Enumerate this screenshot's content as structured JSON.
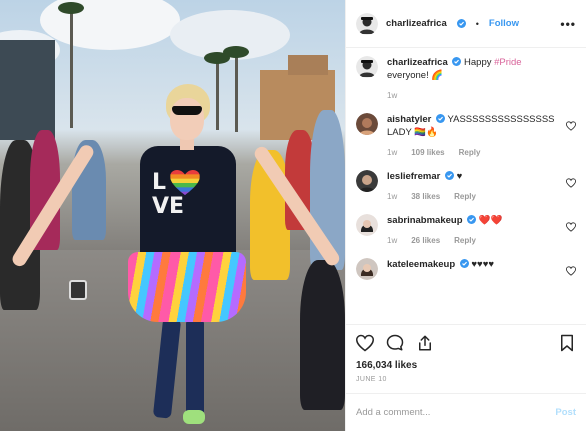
{
  "photo": {
    "shirt_text": [
      "L",
      "VE"
    ],
    "heart_colors": [
      "#e93d3d",
      "#f28b24",
      "#f4d23a",
      "#4bb84a",
      "#3b78d8",
      "#8a4bd0"
    ]
  },
  "header": {
    "username": "charlizeafrica",
    "separator": "•",
    "follow_label": "Follow",
    "more_label": "•••"
  },
  "caption": {
    "username": "charlizeafrica",
    "text_before": "Happy ",
    "hashtag": "#Pride",
    "text_after": " everyone! 🌈",
    "time": "1w"
  },
  "comments": [
    {
      "username": "aishatyler",
      "verified": true,
      "text": "YASSSSSSSSSSSSSSS LADY 🏳️‍🌈🔥",
      "time": "1w",
      "likes": "109 likes",
      "reply": "Reply"
    },
    {
      "username": "lesliefremar",
      "verified": true,
      "text": "♥",
      "time": "1w",
      "likes": "38 likes",
      "reply": "Reply"
    },
    {
      "username": "sabrinabmakeup",
      "verified": true,
      "text": "❤️❤️",
      "time": "1w",
      "likes": "26 likes",
      "reply": "Reply"
    },
    {
      "username": "kateleemakeup",
      "verified": true,
      "text": "♥♥♥♥",
      "time": "",
      "likes": "",
      "reply": ""
    }
  ],
  "stats": {
    "likes": "166,034 likes",
    "date": "June 10"
  },
  "add_comment": {
    "placeholder": "Add a comment...",
    "post_label": "Post"
  },
  "colors": {
    "link_blue": "#3897f0",
    "post_disabled": "#b2dffc",
    "border": "#efefef",
    "meta_grey": "#999999"
  }
}
